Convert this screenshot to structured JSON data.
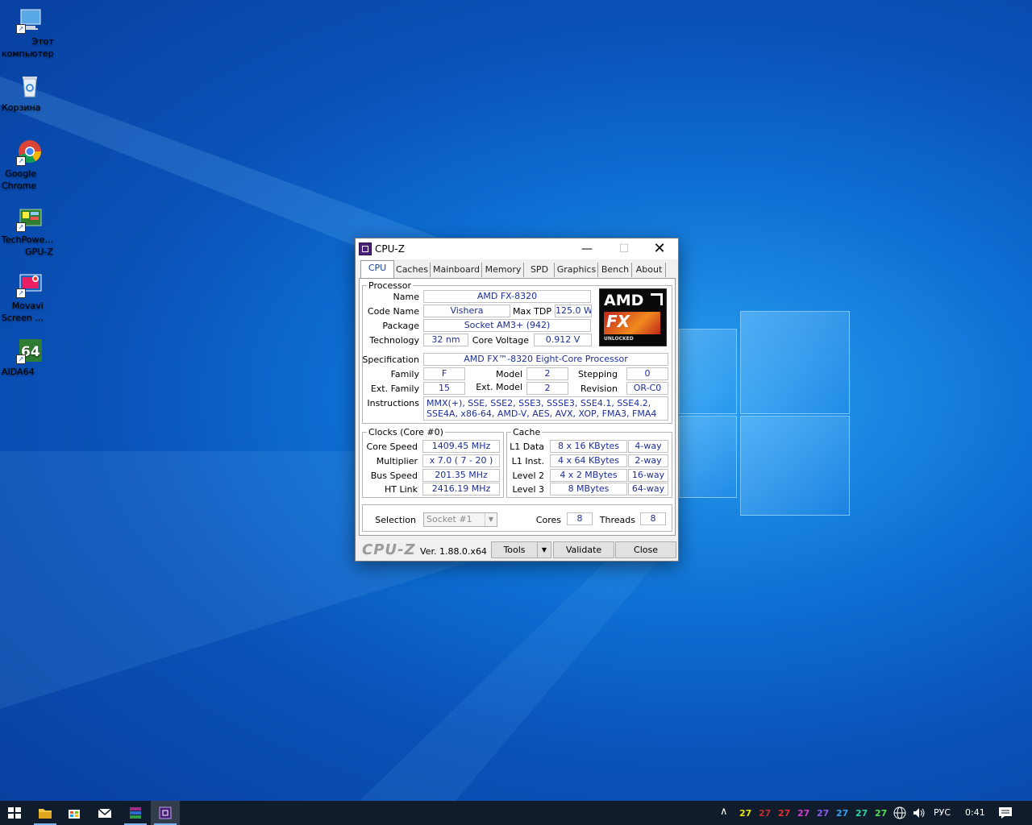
{
  "desktop": {
    "icons": [
      {
        "label": "Этот\nкомпьютер",
        "icon": "computer-icon"
      },
      {
        "label": "Корзина",
        "icon": "recycle-bin-icon"
      },
      {
        "label": "Google\nChrome",
        "icon": "chrome-icon"
      },
      {
        "label": "TechPowe...\nGPU-Z",
        "icon": "gpuz-icon"
      },
      {
        "label": "Movavi\nScreen ...",
        "icon": "movavi-icon"
      },
      {
        "label": "AIDA64",
        "icon": "aida64-icon"
      }
    ]
  },
  "window": {
    "title": "CPU-Z",
    "controls": {
      "minimize": "—",
      "maximize": "☐",
      "close": "✕"
    },
    "tabs": [
      "CPU",
      "Caches",
      "Mainboard",
      "Memory",
      "SPD",
      "Graphics",
      "Bench",
      "About"
    ],
    "active_tab": "CPU",
    "processor": {
      "legend": "Processor",
      "name_label": "Name",
      "name": "AMD FX-8320",
      "codename_label": "Code Name",
      "codename": "Vishera",
      "maxtdp_label": "Max TDP",
      "maxtdp": "125.0 W",
      "package_label": "Package",
      "package": "Socket AM3+ (942)",
      "technology_label": "Technology",
      "technology": "32 nm",
      "corevoltage_label": "Core Voltage",
      "corevoltage": "0.912 V",
      "specification_label": "Specification",
      "specification": "AMD FX™-8320 Eight-Core Processor",
      "family_label": "Family",
      "family": "F",
      "model_label": "Model",
      "model": "2",
      "stepping_label": "Stepping",
      "stepping": "0",
      "extfamily_label": "Ext. Family",
      "extfamily": "15",
      "extmodel_label": "Ext. Model",
      "extmodel": "2",
      "revision_label": "Revision",
      "revision": "OR-C0",
      "instructions_label": "Instructions",
      "instructions": "MMX(+), SSE, SSE2, SSE3, SSSE3, SSE4.1, SSE4.2, SSE4A, x86-64, AMD-V, AES, AVX, XOP, FMA3, FMA4",
      "logo": {
        "brand": "AMD",
        "product": "FX",
        "badge": "UNLOCKED"
      }
    },
    "clocks": {
      "legend": "Clocks (Core #0)",
      "corespeed_label": "Core Speed",
      "corespeed": "1409.45 MHz",
      "multiplier_label": "Multiplier",
      "multiplier": "x 7.0 ( 7 - 20 )",
      "busspeed_label": "Bus Speed",
      "busspeed": "201.35 MHz",
      "htlink_label": "HT Link",
      "htlink": "2416.19 MHz"
    },
    "cache": {
      "legend": "Cache",
      "rows": [
        {
          "label": "L1 Data",
          "size": "8 x 16 KBytes",
          "way": "4-way"
        },
        {
          "label": "L1 Inst.",
          "size": "4 x 64 KBytes",
          "way": "2-way"
        },
        {
          "label": "Level 2",
          "size": "4 x 2 MBytes",
          "way": "16-way"
        },
        {
          "label": "Level 3",
          "size": "8 MBytes",
          "way": "64-way"
        }
      ]
    },
    "selection": {
      "label": "Selection",
      "value": "Socket #1",
      "cores_label": "Cores",
      "cores": "8",
      "threads_label": "Threads",
      "threads": "8"
    },
    "footer": {
      "brand": "CPU-Z",
      "version": "Ver. 1.88.0.x64",
      "tools": "Tools",
      "validate": "Validate",
      "close": "Close"
    }
  },
  "taskbar": {
    "tray_numbers": [
      {
        "value": "27",
        "color": "#e6e600"
      },
      {
        "value": "27",
        "color": "#c03030"
      },
      {
        "value": "27",
        "color": "#e03030"
      },
      {
        "value": "27",
        "color": "#d040d0"
      },
      {
        "value": "27",
        "color": "#8a5cf0"
      },
      {
        "value": "27",
        "color": "#3aa0f0"
      },
      {
        "value": "27",
        "color": "#30d0a0"
      },
      {
        "value": "27",
        "color": "#50e050"
      }
    ],
    "language": "РУС",
    "clock": "0:41"
  }
}
